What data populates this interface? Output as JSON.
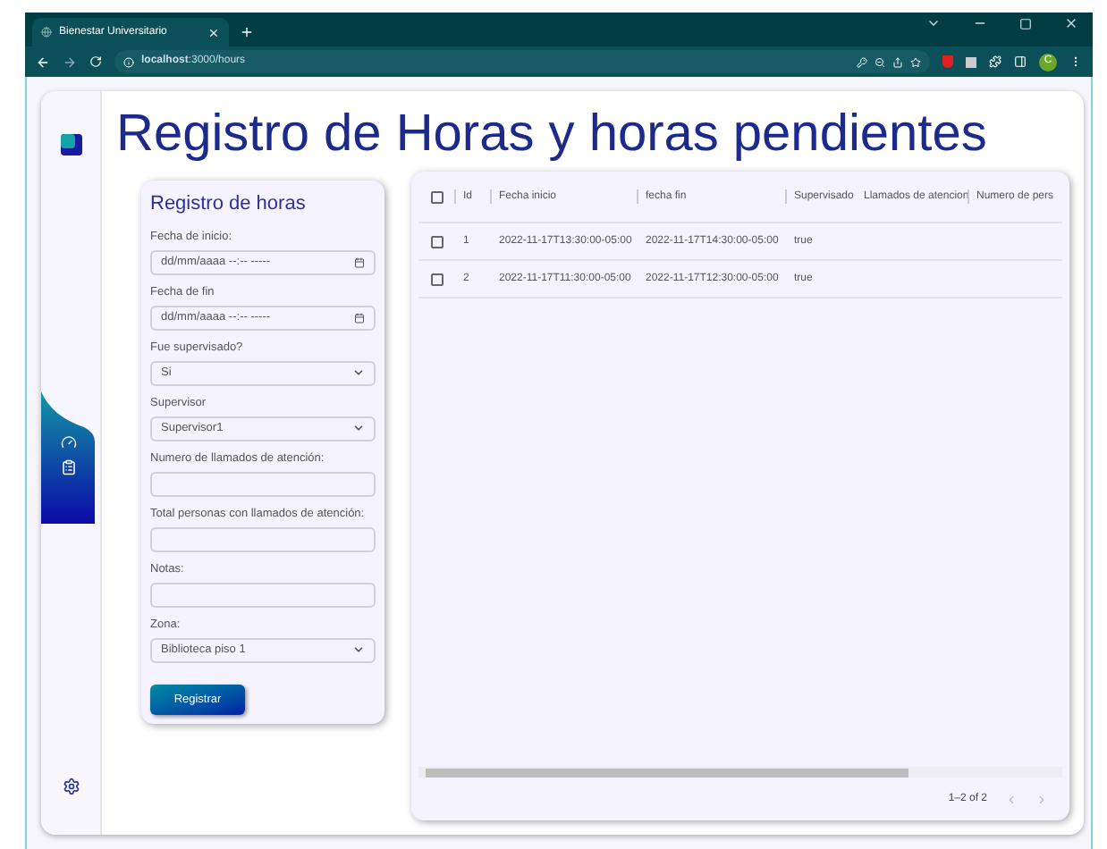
{
  "browser": {
    "tab_title": "Bienestar Universitario",
    "url": "**localhost**:3000/hours",
    "profile_initial": "C"
  },
  "page_title": "Registro de Horas y horas pendientes",
  "form": {
    "title": "Registro de horas",
    "fields": [
      {
        "kind": "date",
        "label": "Fecha de inicio:",
        "value": "dd/mm/aaaa --:-- -----"
      },
      {
        "kind": "date",
        "label": "Fecha de fin",
        "value": "dd/mm/aaaa --:-- -----"
      },
      {
        "kind": "select",
        "label": "Fue supervisado?",
        "value": "Si"
      },
      {
        "kind": "select",
        "label": "Supervisor",
        "value": "Supervisor1"
      },
      {
        "kind": "text",
        "label": "Numero de llamados de atención:"
      },
      {
        "kind": "text",
        "label": "Total personas con llamados de atención:"
      },
      {
        "kind": "text",
        "label": "Notas:"
      },
      {
        "kind": "select",
        "label": "Zona:",
        "value": "Biblioteca piso 1"
      }
    ],
    "submit": "Registrar"
  },
  "table": {
    "all_selected": false,
    "columns": [
      "Id",
      "Fecha inicio",
      "fecha fin",
      "Supervisado",
      "Llamados de atencion",
      "Numero de pers"
    ],
    "rows": [
      {
        "selected": false,
        "cells": [
          "1",
          "2022-11-17T13:30:00-05:00",
          "2022-11-17T14:30:00-05:00",
          "true"
        ]
      },
      {
        "selected": false,
        "cells": [
          "2",
          "2022-11-17T11:30:00-05:00",
          "2022-11-17T12:30:00-05:00",
          "true"
        ]
      }
    ],
    "pagination": "1–2 of 2"
  }
}
